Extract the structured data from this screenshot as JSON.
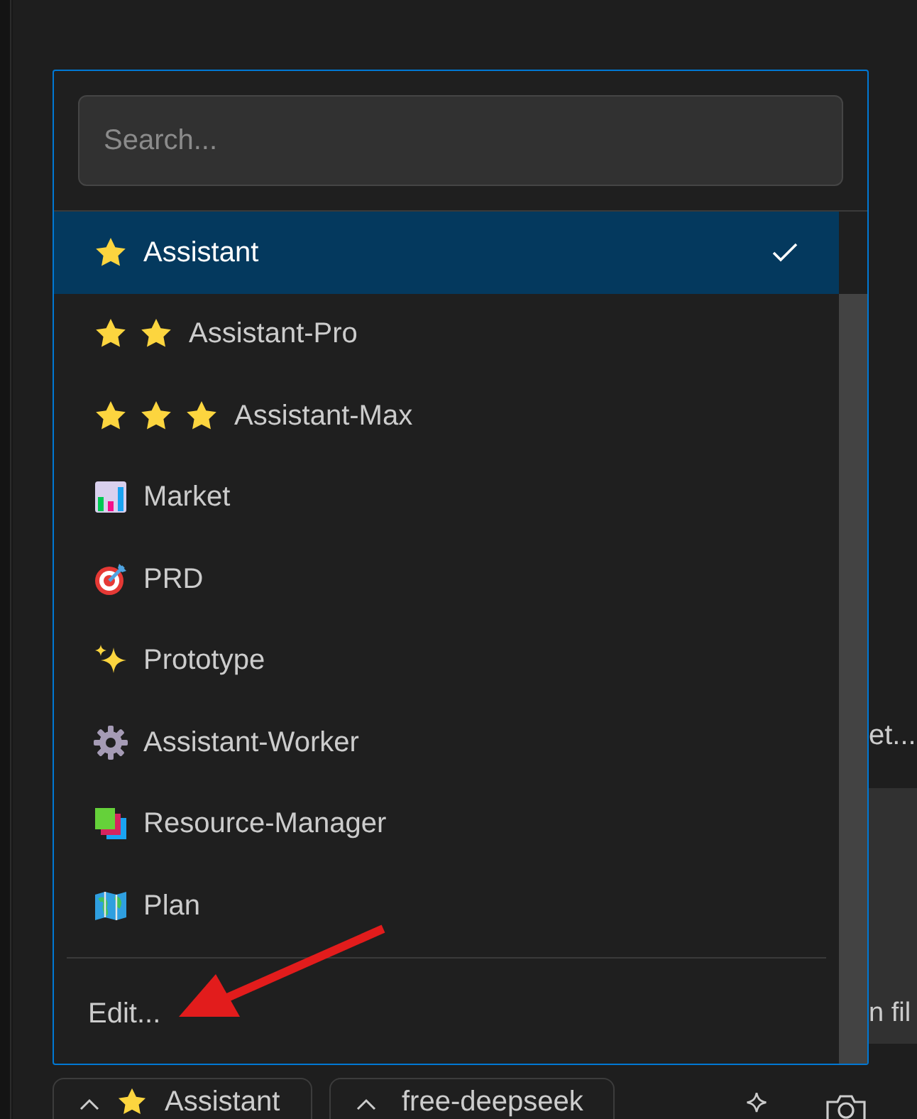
{
  "background": {
    "text_1": "et...",
    "text_2": "n fil"
  },
  "picker": {
    "search": {
      "placeholder": "Search..."
    },
    "items": [
      {
        "label": "Assistant",
        "kind": "single_star",
        "selected": true
      },
      {
        "label": "Assistant-Pro",
        "kind": "double_star",
        "selected": false
      },
      {
        "label": "Assistant-Max",
        "kind": "triple_star",
        "selected": false
      },
      {
        "label": "Market",
        "kind": "chart",
        "selected": false
      },
      {
        "label": "PRD",
        "kind": "target",
        "selected": false
      },
      {
        "label": "Prototype",
        "kind": "sparkles",
        "selected": false
      },
      {
        "label": "Assistant-Worker",
        "kind": "gear",
        "selected": false
      },
      {
        "label": "Resource-Manager",
        "kind": "books",
        "selected": false
      },
      {
        "label": "Plan",
        "kind": "map",
        "selected": false
      }
    ],
    "footer": "Edit..."
  },
  "toolbar": {
    "mode_button": "Assistant",
    "model_button": "free-deepseek"
  }
}
